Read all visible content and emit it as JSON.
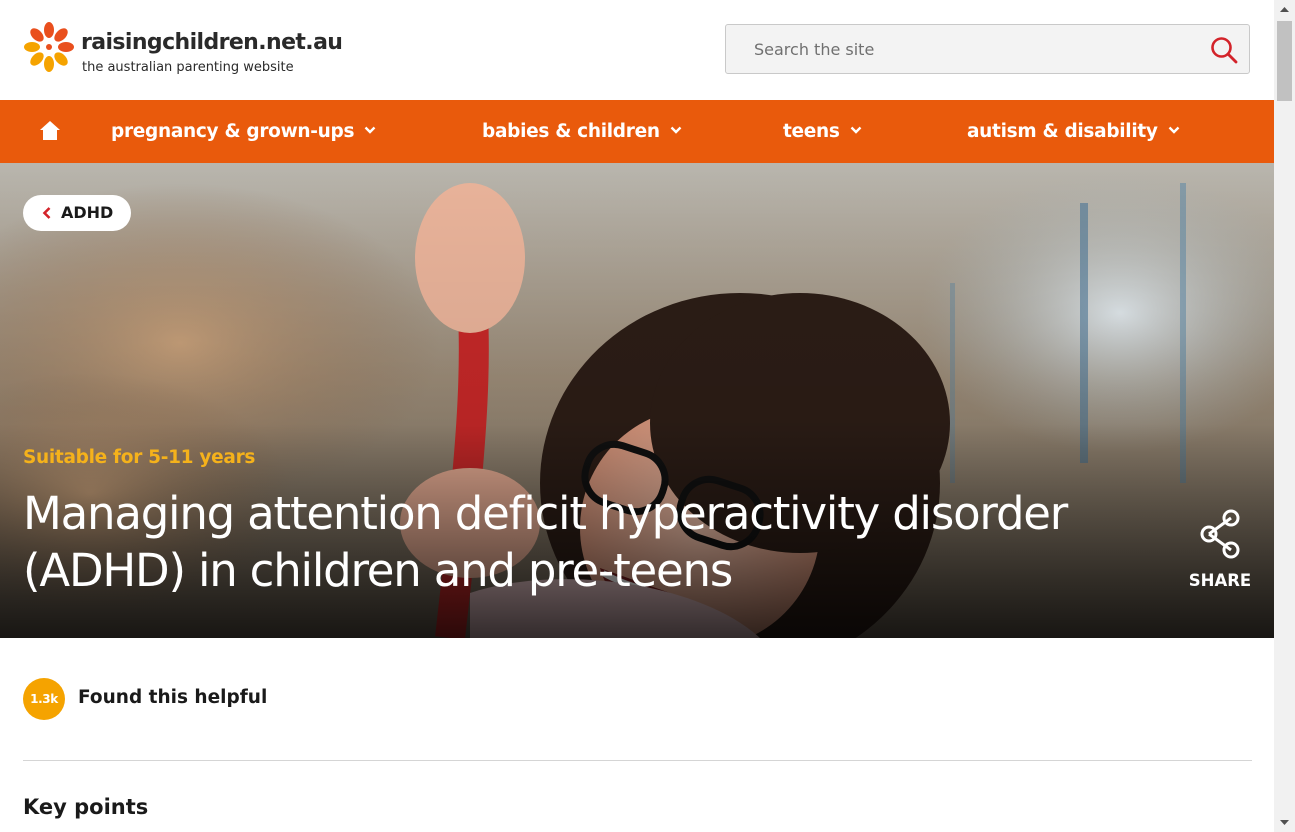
{
  "site": {
    "name": "raisingchildren.net.au",
    "tagline": "the australian parenting website"
  },
  "search": {
    "placeholder": "Search the site"
  },
  "nav": {
    "items": [
      {
        "label": "pregnancy & grown-ups"
      },
      {
        "label": "babies & children"
      },
      {
        "label": "teens"
      },
      {
        "label": "autism & disability"
      }
    ]
  },
  "hero": {
    "back_label": "ADHD",
    "age_label": "Suitable for 5-11 years",
    "title_line1": "Managing attention deficit hyperactivity disorder",
    "title_line2": "(ADHD) in children and pre-teens",
    "share_label": "SHARE"
  },
  "helpful": {
    "count": "1.3k",
    "label": "Found this helpful"
  },
  "content": {
    "section_heading": "Key points"
  },
  "colors": {
    "brand_orange": "#e95a0c",
    "age_yellow": "#f5b21b",
    "badge_orange": "#f5a300",
    "search_icon_red": "#d3232a"
  },
  "icons": {
    "logo": "sunflower-logo-icon",
    "search": "search-icon",
    "home": "home-icon",
    "dropdown": "chevron-down-icon",
    "back": "chevron-left-icon",
    "share": "share-icon"
  }
}
